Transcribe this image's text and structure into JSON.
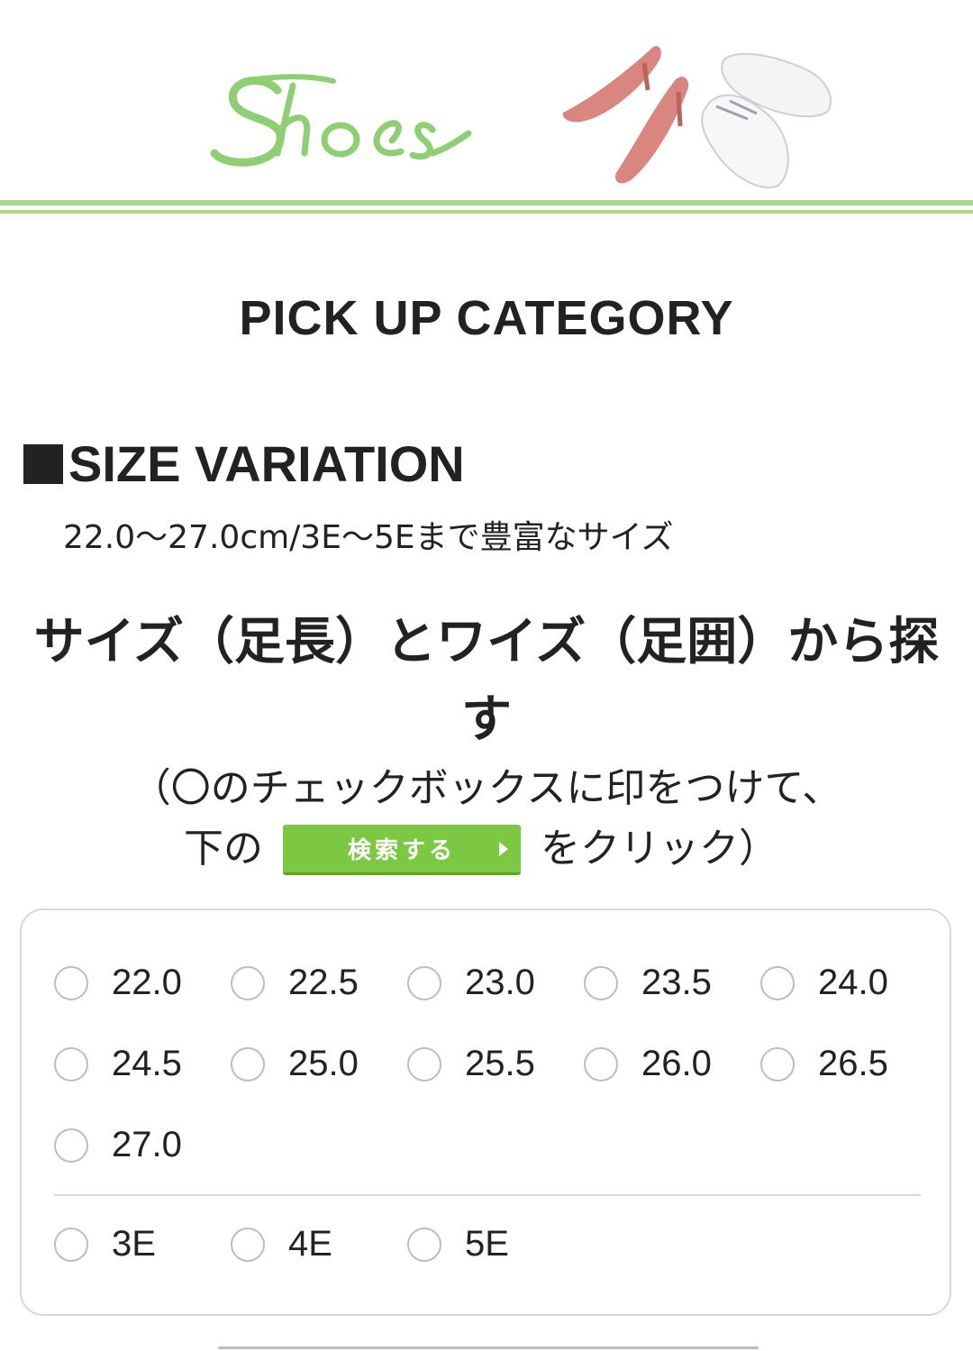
{
  "header": {
    "logo_text": "Shoes",
    "logo_color": "#8fcf73",
    "rule_color": "#a6d98d"
  },
  "pickup": {
    "title": "PICK UP CATEGORY"
  },
  "size_variation": {
    "title": "SIZE VARIATION",
    "bullet": "■",
    "description": "22.0〜27.0cm/3E〜5Eまで豊富なサイズ"
  },
  "search": {
    "heading": "サイズ（足長）とワイズ（足囲）から探す",
    "instruction_line1": "（〇のチェックボックスに印をつけて、",
    "instruction_pre": "下の",
    "button_label": "検索する",
    "instruction_post": "をクリック）",
    "button_color": "#7dc843"
  },
  "sizes": [
    "22.0",
    "22.5",
    "23.0",
    "23.5",
    "24.0",
    "24.5",
    "25.0",
    "25.5",
    "26.0",
    "26.5",
    "27.0"
  ],
  "widths": [
    "3E",
    "4E",
    "5E"
  ]
}
